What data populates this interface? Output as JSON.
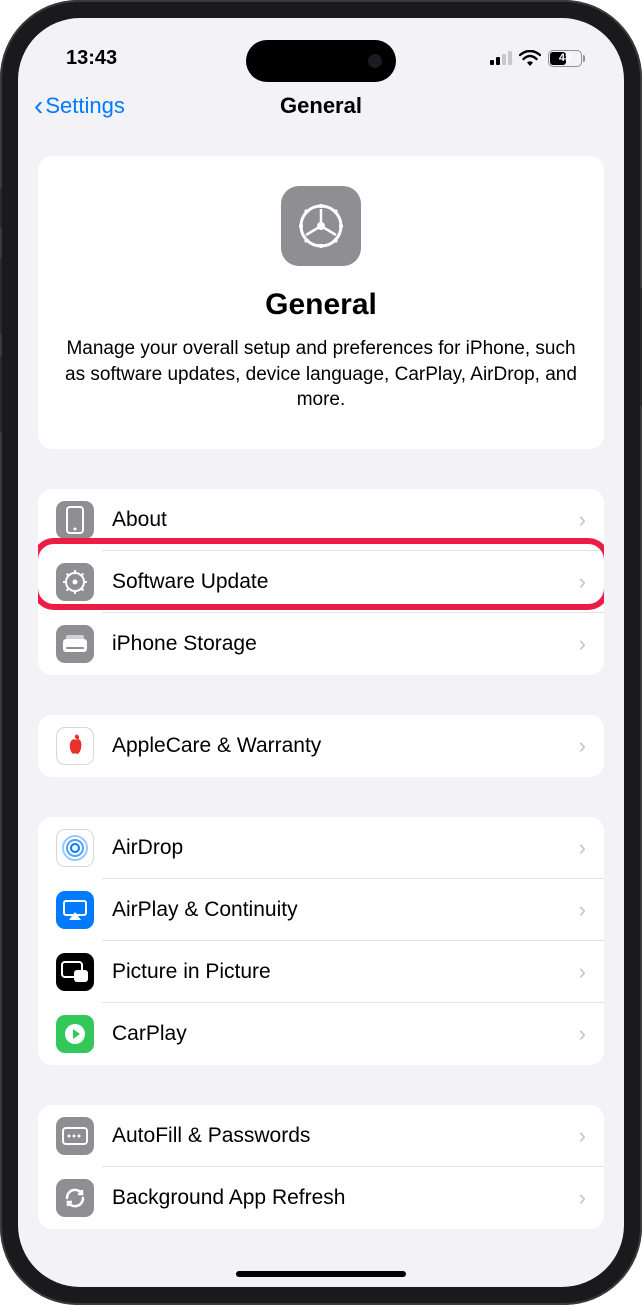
{
  "status": {
    "time": "13:43",
    "battery": "48"
  },
  "nav": {
    "back_label": "Settings",
    "title": "General"
  },
  "hero": {
    "title": "General",
    "description": "Manage your overall setup and preferences for iPhone, such as software updates, device language, CarPlay, AirDrop, and more."
  },
  "sections": [
    {
      "rows": [
        {
          "label": "About",
          "icon": "phone-icon",
          "icon_bg": "ic-gray"
        },
        {
          "label": "Software Update",
          "icon": "gear-icon",
          "icon_bg": "ic-gray",
          "highlighted": true
        },
        {
          "label": "iPhone Storage",
          "icon": "drive-icon",
          "icon_bg": "ic-gray"
        }
      ]
    },
    {
      "rows": [
        {
          "label": "AppleCare & Warranty",
          "icon": "apple-icon",
          "icon_bg": "ic-white"
        }
      ]
    },
    {
      "rows": [
        {
          "label": "AirDrop",
          "icon": "airdrop-icon",
          "icon_bg": "ic-white"
        },
        {
          "label": "AirPlay & Continuity",
          "icon": "airplay-icon",
          "icon_bg": "ic-blue"
        },
        {
          "label": "Picture in Picture",
          "icon": "pip-icon",
          "icon_bg": "ic-black"
        },
        {
          "label": "CarPlay",
          "icon": "carplay-icon",
          "icon_bg": "ic-green"
        }
      ]
    },
    {
      "rows": [
        {
          "label": "AutoFill & Passwords",
          "icon": "autofill-icon",
          "icon_bg": "ic-gray"
        },
        {
          "label": "Background App Refresh",
          "icon": "refresh-icon",
          "icon_bg": "ic-gray"
        }
      ]
    }
  ]
}
